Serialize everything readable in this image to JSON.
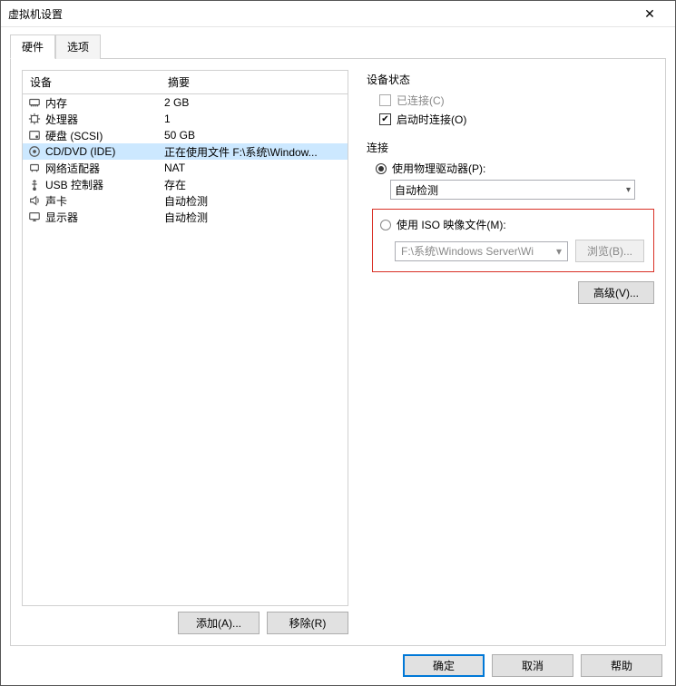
{
  "window": {
    "title": "虚拟机设置"
  },
  "tabs": {
    "hardware": "硬件",
    "options": "选项"
  },
  "table": {
    "header_device": "设备",
    "header_summary": "摘要",
    "rows": [
      {
        "icon": "memory-icon",
        "name": "内存",
        "summary": "2 GB"
      },
      {
        "icon": "cpu-icon",
        "name": "处理器",
        "summary": "1"
      },
      {
        "icon": "hdd-icon",
        "name": "硬盘 (SCSI)",
        "summary": "50 GB"
      },
      {
        "icon": "disc-icon",
        "name": "CD/DVD (IDE)",
        "summary": "正在使用文件 F:\\系统\\Window..."
      },
      {
        "icon": "nic-icon",
        "name": "网络适配器",
        "summary": "NAT"
      },
      {
        "icon": "usb-icon",
        "name": "USB 控制器",
        "summary": "存在"
      },
      {
        "icon": "sound-icon",
        "name": "声卡",
        "summary": "自动检测"
      },
      {
        "icon": "display-icon",
        "name": "显示器",
        "summary": "自动检测"
      }
    ]
  },
  "buttons": {
    "add": "添加(A)...",
    "remove": "移除(R)",
    "browse": "浏览(B)...",
    "advanced": "高级(V)...",
    "ok": "确定",
    "cancel": "取消",
    "help": "帮助"
  },
  "status": {
    "group": "设备状态",
    "connected": "已连接(C)",
    "connect_on_start": "启动时连接(O)"
  },
  "connection": {
    "group": "连接",
    "physical": "使用物理驱动器(P):",
    "physical_value": "自动检测",
    "iso": "使用 ISO 映像文件(M):",
    "iso_path": "F:\\系统\\Windows Server\\Wi"
  }
}
